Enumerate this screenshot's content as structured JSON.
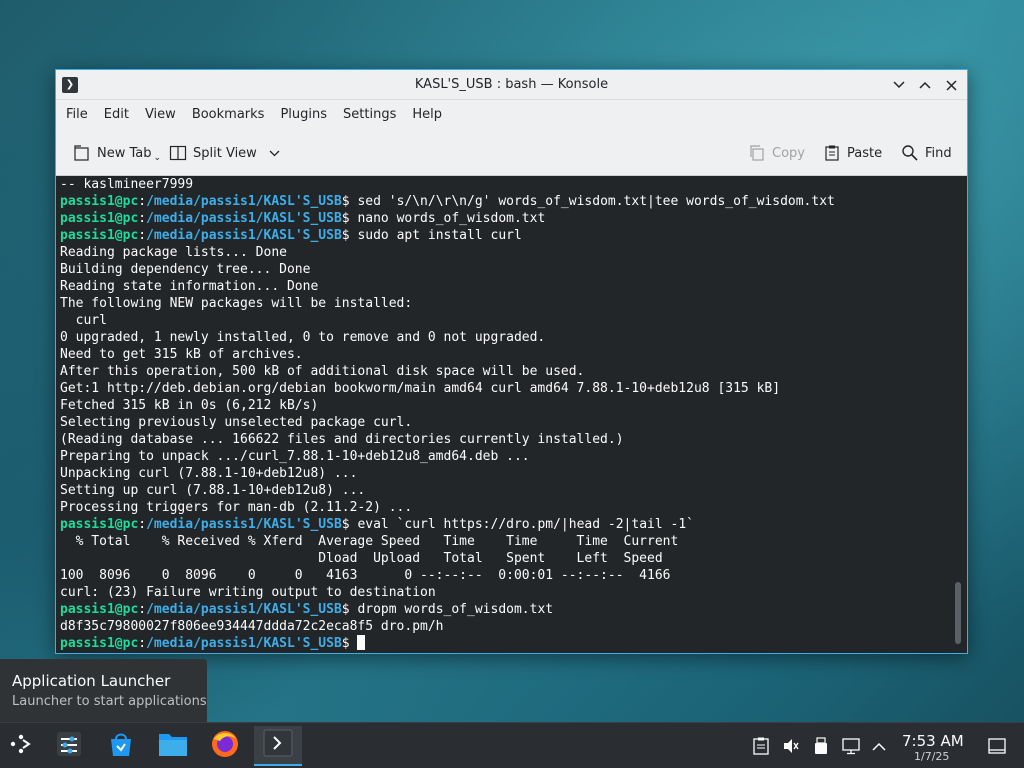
{
  "window": {
    "title": "KASL'S_USB : bash — Konsole"
  },
  "menubar": {
    "items": [
      "File",
      "Edit",
      "View",
      "Bookmarks",
      "Plugins",
      "Settings",
      "Help"
    ]
  },
  "toolbar": {
    "new_tab": "New Tab",
    "split_view": "Split View",
    "copy": "Copy",
    "paste": "Paste",
    "find": "Find"
  },
  "terminal": {
    "prompt": {
      "user": "passis1@pc",
      "path": "/media/passis1/KASL'S_USB"
    },
    "lines": [
      {
        "type": "out",
        "text": "-- kaslmineer7999"
      },
      {
        "type": "cmd",
        "text": "sed 's/\\n/\\r\\n/g' words_of_wisdom.txt|tee words_of_wisdom.txt"
      },
      {
        "type": "cmd",
        "text": "nano words_of_wisdom.txt"
      },
      {
        "type": "cmd",
        "text": "sudo apt install curl"
      },
      {
        "type": "out",
        "text": "Reading package lists... Done"
      },
      {
        "type": "out",
        "text": "Building dependency tree... Done"
      },
      {
        "type": "out",
        "text": "Reading state information... Done"
      },
      {
        "type": "out",
        "text": "The following NEW packages will be installed:"
      },
      {
        "type": "out",
        "text": "  curl"
      },
      {
        "type": "out",
        "text": "0 upgraded, 1 newly installed, 0 to remove and 0 not upgraded."
      },
      {
        "type": "out",
        "text": "Need to get 315 kB of archives."
      },
      {
        "type": "out",
        "text": "After this operation, 500 kB of additional disk space will be used."
      },
      {
        "type": "out",
        "text": "Get:1 http://deb.debian.org/debian bookworm/main amd64 curl amd64 7.88.1-10+deb12u8 [315 kB]"
      },
      {
        "type": "out",
        "text": "Fetched 315 kB in 0s (6,212 kB/s)"
      },
      {
        "type": "out",
        "text": "Selecting previously unselected package curl."
      },
      {
        "type": "out",
        "text": "(Reading database ... 166622 files and directories currently installed.)"
      },
      {
        "type": "out",
        "text": "Preparing to unpack .../curl_7.88.1-10+deb12u8_amd64.deb ..."
      },
      {
        "type": "out",
        "text": "Unpacking curl (7.88.1-10+deb12u8) ..."
      },
      {
        "type": "out",
        "text": "Setting up curl (7.88.1-10+deb12u8) ..."
      },
      {
        "type": "out",
        "text": "Processing triggers for man-db (2.11.2-2) ..."
      },
      {
        "type": "cmd",
        "text": "eval `curl https://dro.pm/|head -2|tail -1`"
      },
      {
        "type": "out",
        "text": "  % Total    % Received % Xferd  Average Speed   Time    Time     Time  Current"
      },
      {
        "type": "out",
        "text": "                                 Dload  Upload   Total   Spent    Left  Speed"
      },
      {
        "type": "out",
        "text": "100  8096    0  8096    0     0   4163      0 --:--:--  0:00:01 --:--:--  4166"
      },
      {
        "type": "out",
        "text": "curl: (23) Failure writing output to destination"
      },
      {
        "type": "cmd",
        "text": "dropm words_of_wisdom.txt"
      },
      {
        "type": "out",
        "text": "d8f35c79800027f806ee934447ddda72c2eca8f5 dro.pm/h"
      },
      {
        "type": "cursor",
        "text": ""
      }
    ]
  },
  "tooltip": {
    "title": "Application Launcher",
    "subtitle": "Launcher to start applications"
  },
  "taskbar": {
    "items": [
      {
        "name": "application-launcher-icon"
      },
      {
        "name": "settings-icon"
      },
      {
        "name": "discover-store-icon"
      },
      {
        "name": "file-manager-icon"
      },
      {
        "name": "firefox-icon"
      },
      {
        "name": "konsole-icon",
        "active": true
      }
    ],
    "tray": [
      "clipboard-icon",
      "volume-muted-icon",
      "usb-drive-icon",
      "network-icon",
      "chevron-up-icon"
    ],
    "clock_time": "7:53 AM",
    "clock_date": "1/7/25"
  },
  "colors": {
    "accent": "#3daee9",
    "prompt_user": "#1cdc9a",
    "terminal_bg": "#232629"
  }
}
